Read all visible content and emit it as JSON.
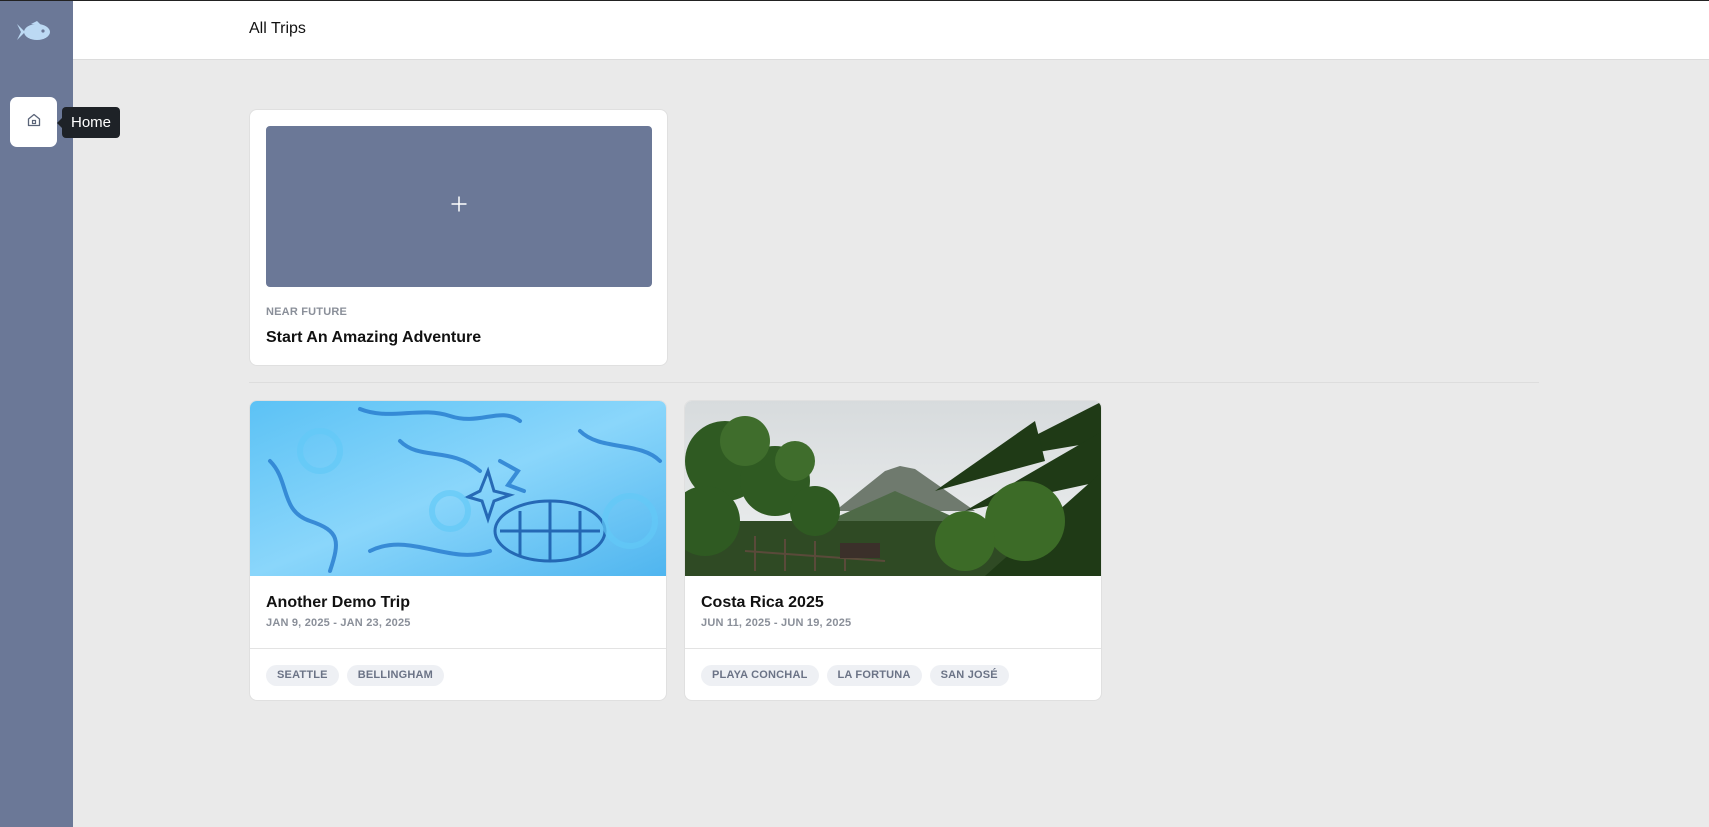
{
  "header": {
    "title": "All Trips"
  },
  "sidebar": {
    "logo_icon": "fish-icon",
    "home": {
      "icon": "home-icon",
      "tooltip": "Home"
    }
  },
  "new_trip": {
    "icon": "plus-icon",
    "eyebrow": "NEAR FUTURE",
    "title": "Start An Amazing Adventure"
  },
  "trips": [
    {
      "title": "Another Demo Trip",
      "dates": "JAN 9, 2025 - JAN 23, 2025",
      "tags": [
        "SEATTLE",
        "BELLINGHAM"
      ]
    },
    {
      "title": "Costa Rica 2025",
      "dates": "JUN 11, 2025 - JUN 19, 2025",
      "tags": [
        "PLAYA CONCHAL",
        "LA FORTUNA",
        "SAN JOSÉ"
      ]
    }
  ],
  "colors": {
    "sidebar": "#6b7897",
    "background": "#eaeaea",
    "tag_bg": "#eef0f4",
    "tag_text": "#6b7386",
    "muted": "#8a8f99"
  }
}
